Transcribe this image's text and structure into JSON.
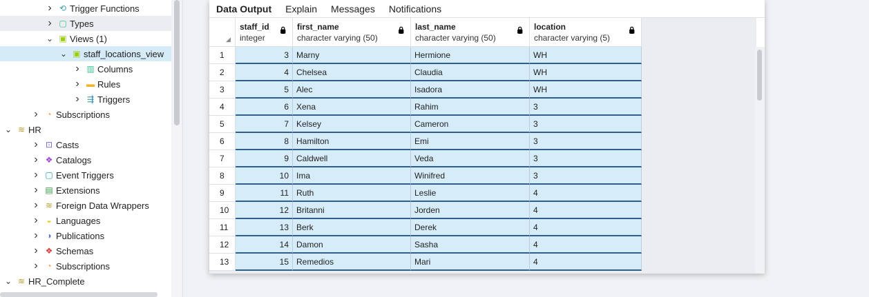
{
  "tree": [
    {
      "label": "Trigger Functions",
      "icon": "trigger-functions-icon",
      "indent": 3,
      "expanded": false,
      "glyph": "⟲",
      "color": "#3aa0a8"
    },
    {
      "label": "Types",
      "icon": "types-icon",
      "indent": 3,
      "expanded": false,
      "glyph": "▢",
      "color": "#3cbf8f"
    },
    {
      "label": "Views (1)",
      "icon": "views-icon",
      "indent": 3,
      "expanded": true,
      "glyph": "▣",
      "color": "#9ccc1a"
    },
    {
      "label": "staff_locations_view",
      "icon": "view-icon",
      "indent": 4,
      "expanded": true,
      "glyph": "▣",
      "color": "#9ccc1a",
      "selected": true
    },
    {
      "label": "Columns",
      "icon": "columns-icon",
      "indent": 5,
      "expanded": false,
      "glyph": "▥",
      "color": "#3cbf8f"
    },
    {
      "label": "Rules",
      "icon": "rules-icon",
      "indent": 5,
      "expanded": false,
      "glyph": "▬",
      "color": "#f0b72a"
    },
    {
      "label": "Triggers",
      "icon": "triggers-icon",
      "indent": 5,
      "expanded": false,
      "glyph": "⇶",
      "color": "#2a8aa8"
    },
    {
      "label": "Subscriptions",
      "icon": "subscriptions-icon",
      "indent": 2,
      "expanded": false,
      "glyph": "◔",
      "color": "#f0a050"
    },
    {
      "label": "HR",
      "icon": "database-icon",
      "indent": 0,
      "expanded": true,
      "glyph": "≋",
      "color": "#b8a030"
    },
    {
      "label": "Casts",
      "icon": "casts-icon",
      "indent": 2,
      "expanded": false,
      "glyph": "⊡",
      "color": "#6a6acc"
    },
    {
      "label": "Catalogs",
      "icon": "catalogs-icon",
      "indent": 2,
      "expanded": false,
      "glyph": "❖",
      "color": "#9a4acc"
    },
    {
      "label": "Event Triggers",
      "icon": "event-triggers-icon",
      "indent": 2,
      "expanded": false,
      "glyph": "▢",
      "color": "#2a9ab8"
    },
    {
      "label": "Extensions",
      "icon": "extensions-icon",
      "indent": 2,
      "expanded": false,
      "glyph": "▤",
      "color": "#3a9a4a"
    },
    {
      "label": "Foreign Data Wrappers",
      "icon": "foreign-data-wrappers-icon",
      "indent": 2,
      "expanded": false,
      "glyph": "≋",
      "color": "#b8a030"
    },
    {
      "label": "Languages",
      "icon": "languages-icon",
      "indent": 2,
      "expanded": false,
      "glyph": "◒",
      "color": "#e8d020"
    },
    {
      "label": "Publications",
      "icon": "publications-icon",
      "indent": 2,
      "expanded": false,
      "glyph": "◑",
      "color": "#5a7acc"
    },
    {
      "label": "Schemas",
      "icon": "schemas-icon",
      "indent": 2,
      "expanded": false,
      "glyph": "❖",
      "color": "#d04040"
    },
    {
      "label": "Subscriptions",
      "icon": "subscriptions-icon",
      "indent": 2,
      "expanded": false,
      "glyph": "◔",
      "color": "#f0a050"
    },
    {
      "label": "HR_Complete",
      "icon": "database-icon",
      "indent": 0,
      "expanded": true,
      "glyph": "≋",
      "color": "#b8a030"
    }
  ],
  "tabs": [
    {
      "label": "Data Output",
      "active": true
    },
    {
      "label": "Explain"
    },
    {
      "label": "Messages"
    },
    {
      "label": "Notifications"
    }
  ],
  "columns": [
    {
      "name": "staff_id",
      "type": "integer"
    },
    {
      "name": "first_name",
      "type": "character varying (50)"
    },
    {
      "name": "last_name",
      "type": "character varying (50)"
    },
    {
      "name": "location",
      "type": "character varying (5)"
    }
  ],
  "rows": [
    [
      "1",
      "3",
      "Marny",
      "Hermione",
      "WH"
    ],
    [
      "2",
      "4",
      "Chelsea",
      "Claudia",
      "WH"
    ],
    [
      "3",
      "5",
      "Alec",
      "Isadora",
      "WH"
    ],
    [
      "4",
      "6",
      "Xena",
      "Rahim",
      "3"
    ],
    [
      "5",
      "7",
      "Kelsey",
      "Cameron",
      "3"
    ],
    [
      "6",
      "8",
      "Hamilton",
      "Emi",
      "3"
    ],
    [
      "7",
      "9",
      "Caldwell",
      "Veda",
      "3"
    ],
    [
      "8",
      "10",
      "Ima",
      "Winifred",
      "3"
    ],
    [
      "9",
      "11",
      "Ruth",
      "Leslie",
      "4"
    ],
    [
      "10",
      "12",
      "Britanni",
      "Jorden",
      "4"
    ],
    [
      "11",
      "13",
      "Berk",
      "Derek",
      "4"
    ],
    [
      "12",
      "14",
      "Damon",
      "Sasha",
      "4"
    ],
    [
      "13",
      "15",
      "Remedios",
      "Mari",
      "4"
    ]
  ]
}
